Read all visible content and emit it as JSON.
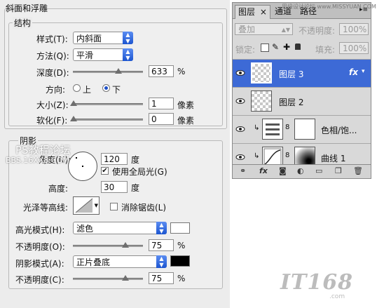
{
  "dialog": {
    "bevel": {
      "title": "斜面和浮雕",
      "structure_title": "结构",
      "style_label": "样式(T):",
      "style_value": "内斜面",
      "technique_label": "方法(Q):",
      "technique_value": "平滑",
      "depth_label": "深度(D):",
      "depth_value": "633",
      "depth_unit": "%",
      "direction_label": "方向:",
      "direction_up": "上",
      "direction_down": "下",
      "direction_selected": "下",
      "size_label": "大小(Z):",
      "size_value": "1",
      "size_unit": "像素",
      "soften_label": "软化(F):",
      "soften_value": "0",
      "soften_unit": "像素"
    },
    "shading": {
      "title": "阴影",
      "angle_label": "角度(N):",
      "angle_value": "120",
      "angle_unit": "度",
      "global_light_label": "使用全局光(G)",
      "global_light_checked": true,
      "altitude_label": "高度:",
      "altitude_value": "30",
      "altitude_unit": "度",
      "gloss_contour_label": "光泽等高线:",
      "anti_aliased_label": "消除锯齿(L)",
      "anti_aliased_checked": false,
      "highlight_mode_label": "高光模式(H):",
      "highlight_mode_value": "滤色",
      "highlight_color": "#ffffff",
      "highlight_opacity_label": "不透明度(O):",
      "highlight_opacity_value": "75",
      "highlight_opacity_unit": "%",
      "shadow_mode_label": "阴影模式(A):",
      "shadow_mode_value": "正片叠底",
      "shadow_color": "#000000",
      "shadow_opacity_label": "不透明度(C):",
      "shadow_opacity_value": "75",
      "shadow_opacity_unit": "%"
    },
    "watermark": {
      "line1": "PS教程论坛",
      "line2": "BBS.16XX8.COM"
    }
  },
  "layers_panel": {
    "tabs": [
      "图层",
      "通道",
      "路径"
    ],
    "tab_close": "×",
    "tab_watermark": "思缘设计论坛 www.MISSYUAN.COM",
    "blend_mode": "叠加",
    "opacity_label": "不透明度:",
    "opacity_value": "100%",
    "lock_label": "锁定:",
    "fill_label": "填充:",
    "fill_value": "100%",
    "layers": [
      {
        "name": "图层 3",
        "selected": true,
        "fx": "fx"
      },
      {
        "name": "图层 2",
        "selected": false
      },
      {
        "name": "色相/饱...",
        "selected": false
      },
      {
        "name": "曲线 1",
        "selected": false
      }
    ]
  },
  "site_logo": {
    "text": "IT168",
    "suffix": ".com"
  },
  "colors": {
    "accent": "#3d6ad6",
    "dialog_bg": "#ececec",
    "panel_bg": "#d9d9d9"
  }
}
